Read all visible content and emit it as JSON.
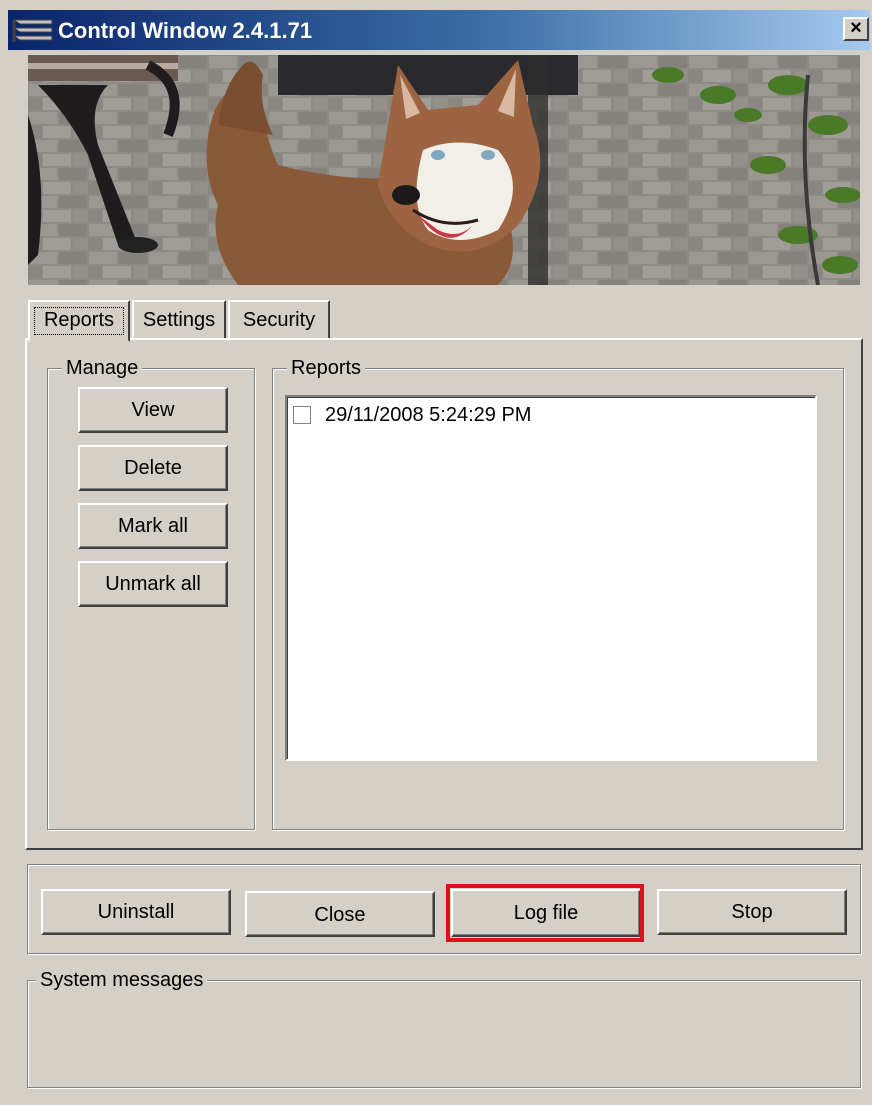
{
  "window": {
    "title": "Control Window  2.4.1.71",
    "close_label": "×",
    "app_icon": "app-icon",
    "banner_image": "dog-photo"
  },
  "tabs": [
    {
      "label": "Reports",
      "active": true
    },
    {
      "label": "Settings",
      "active": false
    },
    {
      "label": "Security",
      "active": false
    }
  ],
  "manage": {
    "legend": "Manage",
    "buttons": [
      "View",
      "Delete",
      "Mark all",
      "Unmark all"
    ]
  },
  "reports": {
    "legend": "Reports",
    "items": [
      {
        "text": "29/11/2008 5:24:29 PM",
        "checked": false
      }
    ]
  },
  "actions": {
    "buttons": [
      "Uninstall",
      "Close",
      "Log file",
      "Stop"
    ],
    "highlighted": "Log file",
    "highlight_color": "#e0101a"
  },
  "system_messages": {
    "legend": "System messages",
    "text": ""
  }
}
